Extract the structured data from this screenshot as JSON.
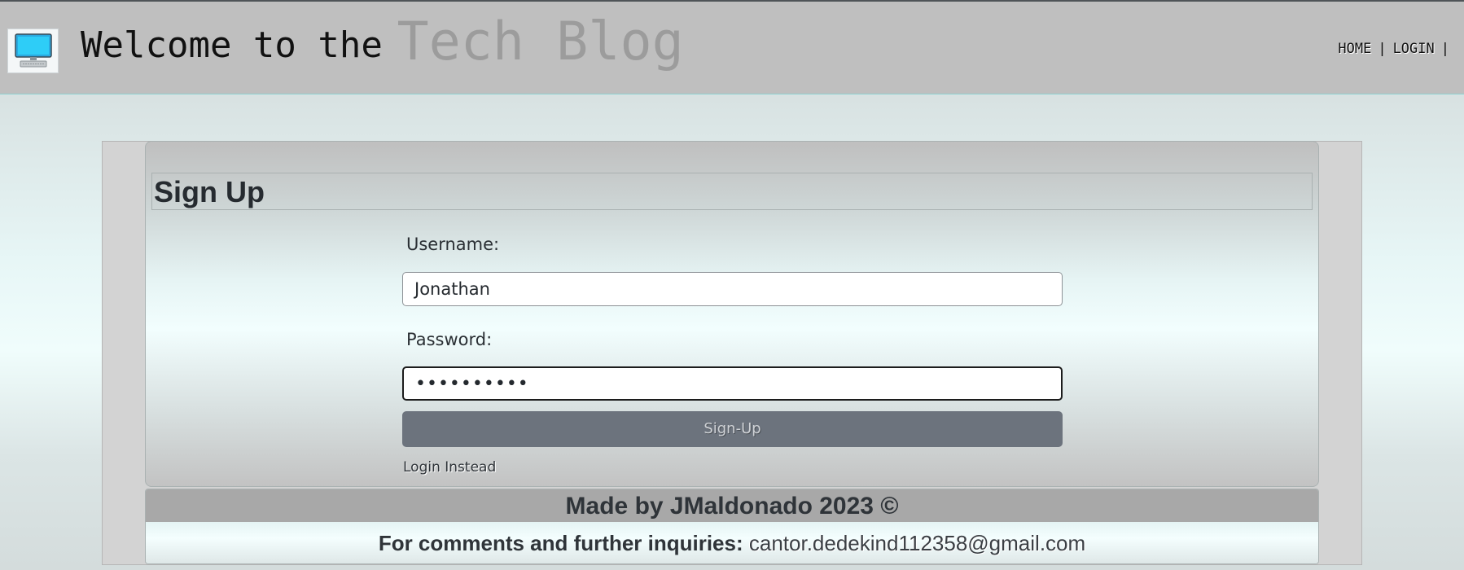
{
  "header": {
    "welcome_text": "Welcome to the",
    "brand_text": "Tech Blog",
    "nav": [
      {
        "label": "HOME"
      },
      {
        "label": "LOGIN"
      }
    ],
    "separator": "|",
    "logo_icon": "computer-monitor-icon"
  },
  "signup": {
    "title": "Sign Up",
    "username_label": "Username:",
    "username_value": "Jonathan",
    "password_label": "Password:",
    "password_value": "••••••••••",
    "button_label": "Sign-Up",
    "login_link": "Login Instead"
  },
  "footer": {
    "credit": "Made by JMaldonado 2023 ©",
    "contact_label": "For comments and further inquiries:",
    "email": "cantor.dedekind112358@gmail.com"
  },
  "colors": {
    "header_bg": "#bfbfbf",
    "button_bg": "#6c737d",
    "brand_text": "#9c9c9c"
  }
}
